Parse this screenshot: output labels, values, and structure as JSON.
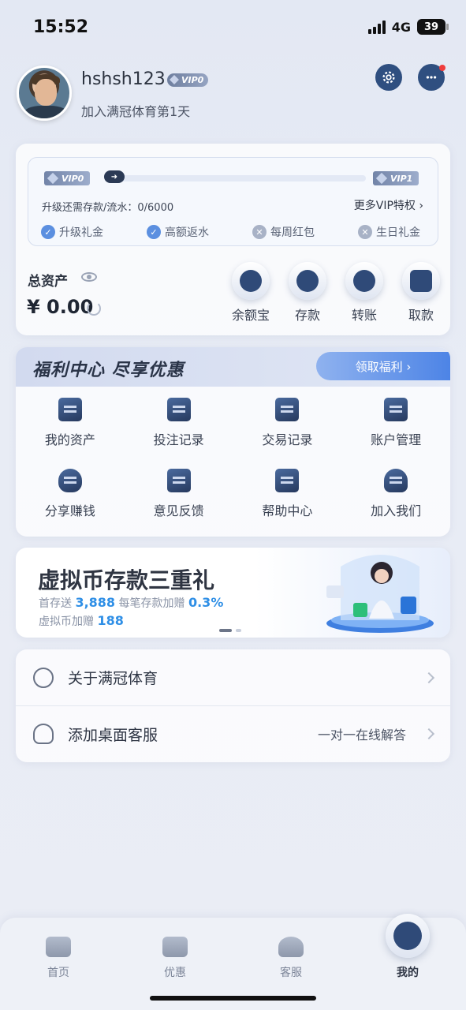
{
  "status_bar": {
    "time": "15:52",
    "network": "4G",
    "battery": "39"
  },
  "profile": {
    "username": "hshsh123",
    "vip_badge": "VIP0",
    "join_text": "加入满冠体育第1天"
  },
  "vip_card": {
    "current_level": "VIP0",
    "next_level": "VIP1",
    "progress": 0,
    "upgrade_text": "升级还需存款/流水：0/6000",
    "more_vip": "更多VIP特权",
    "perks": [
      {
        "label": "升级礼金",
        "enabled": true
      },
      {
        "label": "高额返水",
        "enabled": true
      },
      {
        "label": "每周红包",
        "enabled": false
      },
      {
        "label": "生日礼金",
        "enabled": false
      }
    ],
    "assets_label": "总资产",
    "assets_value": "¥ 0.00",
    "actions": [
      {
        "label": "余额宝",
        "icon": "coins-icon"
      },
      {
        "label": "存款",
        "icon": "wallet-icon"
      },
      {
        "label": "转账",
        "icon": "transfer-icon"
      },
      {
        "label": "取款",
        "icon": "card-icon"
      }
    ]
  },
  "welfare": {
    "title": "福利中心  尽享优惠",
    "cta": "领取福利 ›",
    "items": [
      {
        "label": "我的资产",
        "icon": "wallet-icon"
      },
      {
        "label": "投注记录",
        "icon": "bet-record-icon"
      },
      {
        "label": "交易记录",
        "icon": "transaction-icon"
      },
      {
        "label": "账户管理",
        "icon": "folder-icon"
      },
      {
        "label": "分享赚钱",
        "icon": "handshake-icon"
      },
      {
        "label": "意见反馈",
        "icon": "feedback-icon"
      },
      {
        "label": "帮助中心",
        "icon": "help-book-icon"
      },
      {
        "label": "加入我们",
        "icon": "users-icon"
      }
    ]
  },
  "banner": {
    "title": "虚拟币存款三重礼",
    "line1_prefix": "首存送",
    "line1_value": "3,888",
    "line1_mid": "每笔存款加赠",
    "line1_value2": "0.3%",
    "line2_prefix": "虚拟币加赠",
    "line2_value": "188"
  },
  "list": [
    {
      "label": "关于满冠体育",
      "extra": "",
      "icon": "info-icon"
    },
    {
      "label": "添加桌面客服",
      "extra": "一对一在线解答",
      "icon": "headset-icon"
    }
  ],
  "tabbar": [
    {
      "label": "首页",
      "icon": "home-icon"
    },
    {
      "label": "优惠",
      "icon": "discount-icon"
    },
    {
      "label": "客服",
      "icon": "headset-icon"
    },
    {
      "label": "我的",
      "icon": "user-icon",
      "active": true
    }
  ],
  "colors": {
    "accent": "#2f4a78",
    "link_blue": "#2f8fe6",
    "cta_blue": "#4d84e6"
  }
}
